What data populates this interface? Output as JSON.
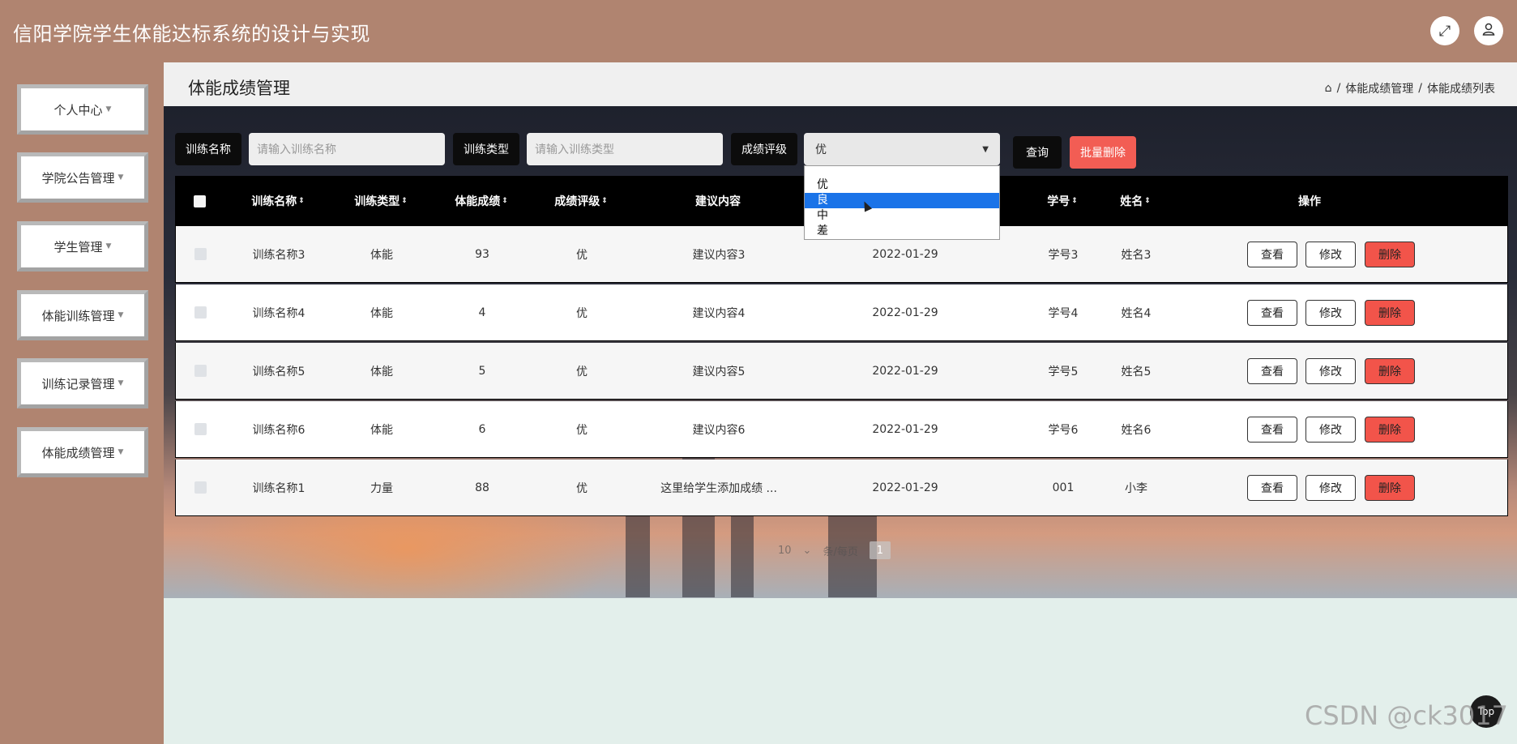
{
  "app": {
    "title": "信阳学院学生体能达标系统的设计与实现"
  },
  "topbar": {
    "fullscreen_icon": "expand-icon",
    "user_icon": "user-icon"
  },
  "sidebar": {
    "items": [
      {
        "label": "个人中心"
      },
      {
        "label": "学院公告管理"
      },
      {
        "label": "学生管理"
      },
      {
        "label": "体能训练管理"
      },
      {
        "label": "训练记录管理"
      },
      {
        "label": "体能成绩管理"
      }
    ]
  },
  "page": {
    "title": "体能成绩管理",
    "breadcrumb": [
      "体能成绩管理",
      "体能成绩列表"
    ],
    "sep": "/"
  },
  "search": {
    "name_label": "训练名称",
    "name_placeholder": "请输入训练名称",
    "type_label": "训练类型",
    "type_placeholder": "请输入训练类型",
    "grade_label": "成绩评级",
    "grade_value": "优",
    "grade_options": [
      "优",
      "良",
      "中",
      "差"
    ],
    "grade_highlighted": "良",
    "query_button": "查询",
    "batch_delete_button": "批量删除"
  },
  "table": {
    "columns": [
      "训练名称",
      "训练类型",
      "体能成绩",
      "成绩评级",
      "建议内容",
      "学号",
      "姓名",
      "操作"
    ],
    "rows": [
      {
        "name": "训练名称3",
        "type": "体能",
        "score": "93",
        "grade": "优",
        "advice": "建议内容3",
        "date": "2022-01-29",
        "student_no": "学号3",
        "student_name": "姓名3"
      },
      {
        "name": "训练名称4",
        "type": "体能",
        "score": "4",
        "grade": "优",
        "advice": "建议内容4",
        "date": "2022-01-29",
        "student_no": "学号4",
        "student_name": "姓名4"
      },
      {
        "name": "训练名称5",
        "type": "体能",
        "score": "5",
        "grade": "优",
        "advice": "建议内容5",
        "date": "2022-01-29",
        "student_no": "学号5",
        "student_name": "姓名5"
      },
      {
        "name": "训练名称6",
        "type": "体能",
        "score": "6",
        "grade": "优",
        "advice": "建议内容6",
        "date": "2022-01-29",
        "student_no": "学号6",
        "student_name": "姓名6"
      },
      {
        "name": "训练名称1",
        "type": "力量",
        "score": "88",
        "grade": "优",
        "advice": "这里给学生添加成绩 ...",
        "date": "2022-01-29",
        "student_no": "001",
        "student_name": "小李"
      }
    ],
    "actions": {
      "view": "查看",
      "edit": "修改",
      "delete": "删除"
    }
  },
  "pagination": {
    "page_size": "10",
    "per_page_label": "条/每页",
    "current_page": "1"
  },
  "overlay": {
    "top_button": "Top",
    "watermark": "CSDN @ck3017"
  }
}
